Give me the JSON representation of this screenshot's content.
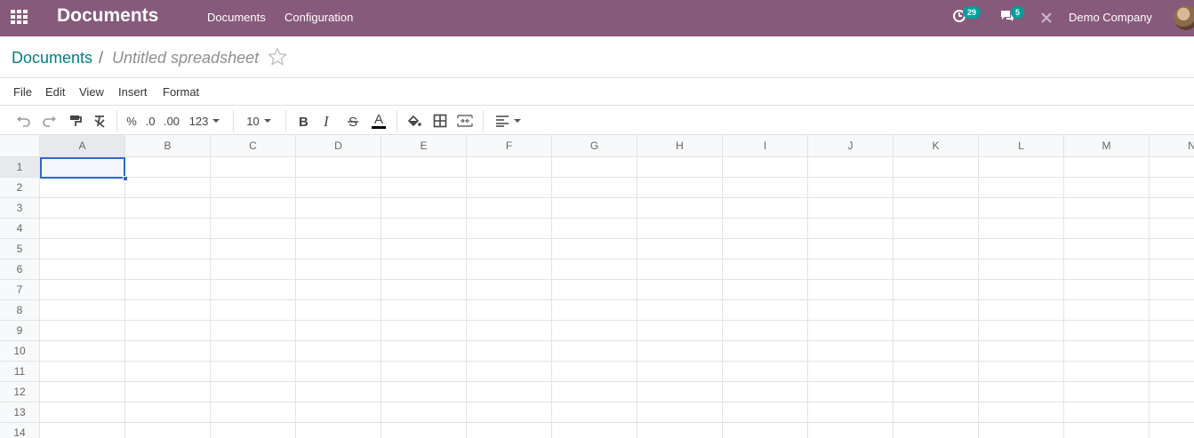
{
  "navbar": {
    "app_title": "Documents",
    "menus": [
      "Documents",
      "Configuration"
    ],
    "activity_count": "29",
    "message_count": "5",
    "company": "Demo Company"
  },
  "breadcrumb": {
    "parent": "Documents",
    "separator": "/",
    "current": "Untitled spreadsheet"
  },
  "menubar": {
    "items": [
      "File",
      "Edit",
      "View",
      "Insert",
      "Format"
    ]
  },
  "toolbar": {
    "percent": "%",
    "decrease_decimal": ".0",
    "increase_decimal": ".00",
    "number_format": "123",
    "font_size": "10"
  },
  "sheet": {
    "columns": [
      "A",
      "B",
      "C",
      "D",
      "E",
      "F",
      "G",
      "H",
      "I",
      "J",
      "K",
      "L",
      "M",
      "N"
    ],
    "rows": [
      "1",
      "2",
      "3",
      "4",
      "5",
      "6",
      "7",
      "8",
      "9",
      "10",
      "11",
      "12",
      "13",
      "14"
    ],
    "selected_cell": "A1"
  },
  "colors": {
    "navbar": "#875a7b",
    "link": "#017e84",
    "selection": "#3266ca",
    "badge": "#00a09d"
  }
}
